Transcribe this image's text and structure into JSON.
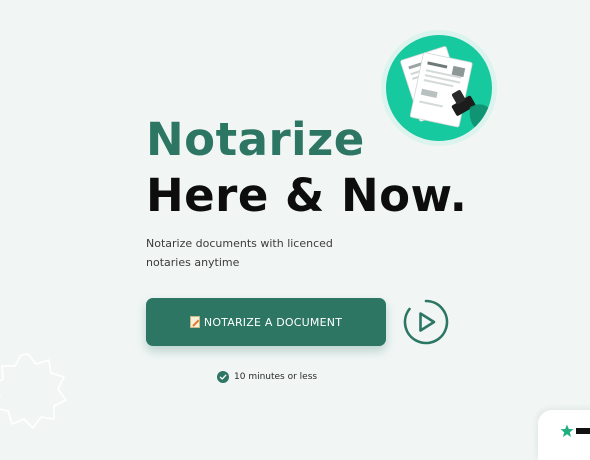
{
  "hero": {
    "title_line1": "Notarize",
    "title_line2": "Here & Now.",
    "subtitle": "Notarize documents with licenced notaries anytime"
  },
  "cta": {
    "label": "NOTARIZE A DOCUMENT",
    "icon": "memo-icon"
  },
  "play_button": {
    "icon": "play-icon"
  },
  "note": {
    "text": "10 minutes or less",
    "icon": "check-circle-icon"
  },
  "colors": {
    "brand_green": "#2c7663",
    "accent_teal": "#16c99f",
    "background": "#f1f6f5",
    "title_black": "#0d0d0d"
  },
  "icons": {
    "illustration": "documents-stamp-illustration",
    "decor": "badge-outline-icon",
    "corner": "star-icon"
  }
}
